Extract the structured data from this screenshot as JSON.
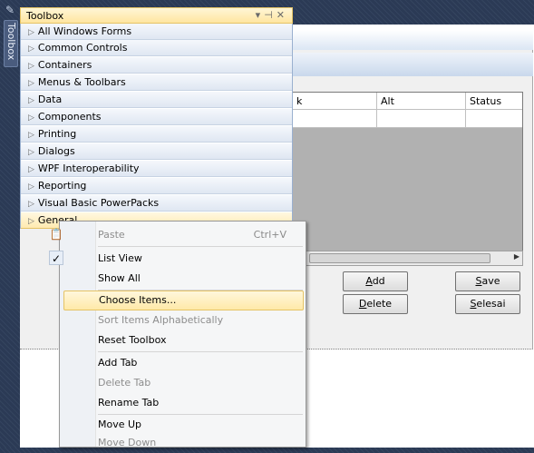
{
  "toolbox": {
    "title": "Toolbox",
    "side_tab": "Toolbox",
    "categories": [
      "All Windows Forms",
      "Common Controls",
      "Containers",
      "Menus & Toolbars",
      "Data",
      "Components",
      "Printing",
      "Dialogs",
      "WPF Interoperability",
      "Reporting",
      "Visual Basic PowerPacks",
      "General"
    ]
  },
  "grid": {
    "columns": [
      "k",
      "Alt",
      "Status"
    ]
  },
  "buttons": {
    "add": {
      "mnemonic": "A",
      "rest": "dd"
    },
    "save": {
      "mnemonic": "S",
      "rest": "ave"
    },
    "delete": {
      "mnemonic": "D",
      "rest": "elete"
    },
    "selesai": {
      "mnemonic": "S",
      "rest": "elesai"
    }
  },
  "context_menu": {
    "paste": {
      "label": "Paste",
      "shortcut": "Ctrl+V"
    },
    "list_view": "List View",
    "show_all": "Show All",
    "choose_items": "Choose Items...",
    "sort_items": "Sort Items Alphabetically",
    "reset_toolbox": "Reset Toolbox",
    "add_tab": "Add Tab",
    "delete_tab": "Delete Tab",
    "rename_tab": "Rename Tab",
    "move_up": "Move Up",
    "move_down": "Move Down"
  },
  "icons": {
    "pin": "pin-icon",
    "dropdown": "dropdown-icon",
    "autohide": "autohide-pin-icon",
    "close": "close-icon",
    "expand": "expand-triangle-icon",
    "check": "checkmark-icon",
    "paste": "paste-icon"
  },
  "colors": {
    "highlight": "#ffe9a8",
    "toolbox_title_bg": "#ffe6a0",
    "grid_bg": "#b1b1b1"
  }
}
